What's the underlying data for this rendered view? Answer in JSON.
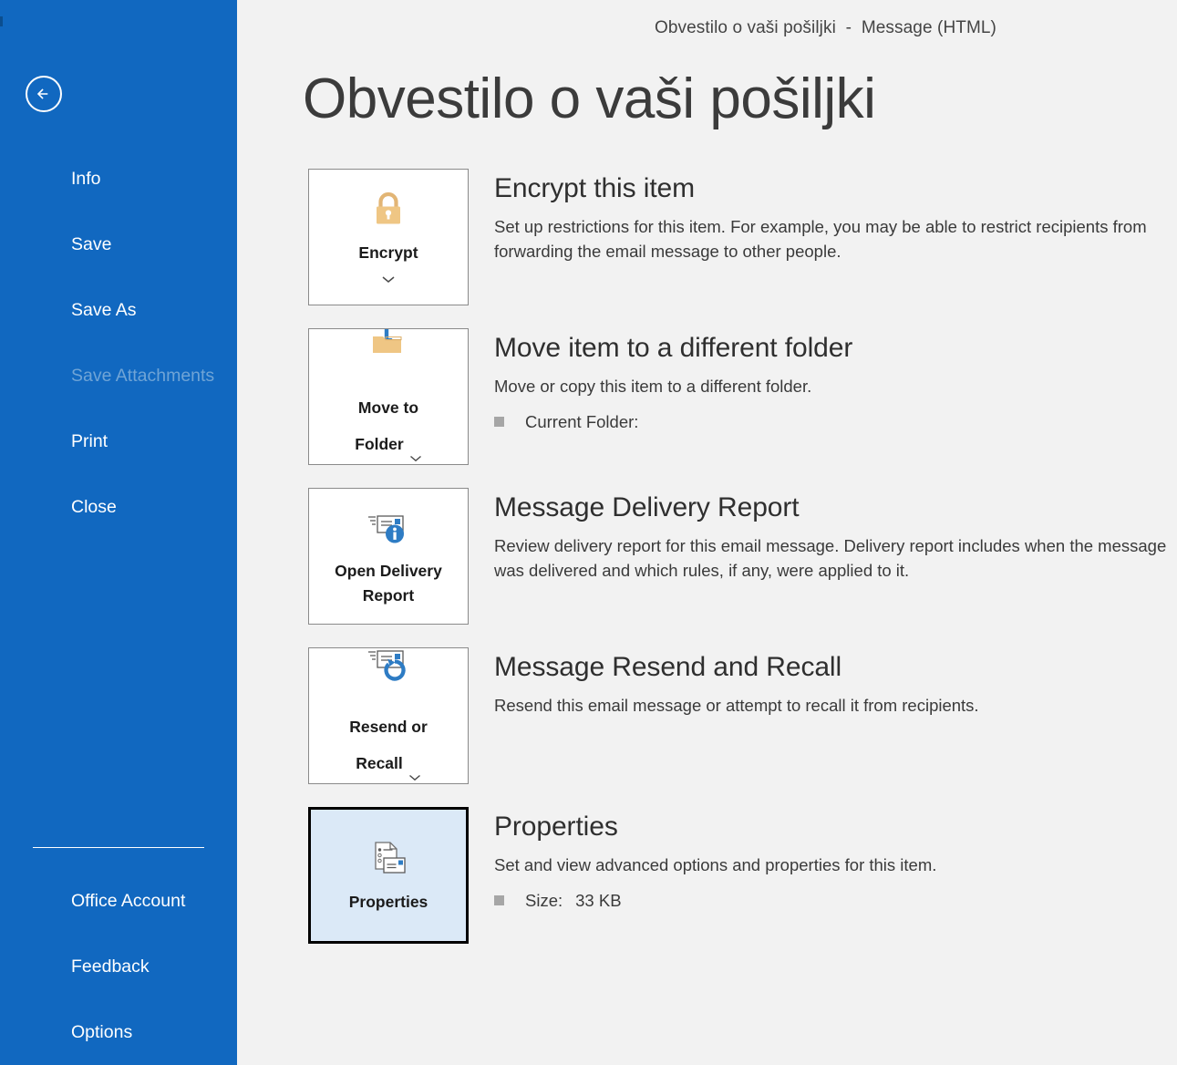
{
  "window": {
    "title": "Obvestilo o vaši pošiljki  -  Message (HTML)"
  },
  "colors": {
    "sidebar_blue": "#1168C0",
    "main_background": "#F2F2F2",
    "tile_selected_fill": "#DBE9F7",
    "tile_selected_border": "#000000",
    "accent_gold": "#E8BC7E",
    "accent_blue": "#2E7CC4",
    "disabled_text": "#6FA4D6"
  },
  "sidebar": {
    "back_icon": "back-arrow-icon",
    "items": [
      {
        "label": "Info",
        "disabled": false
      },
      {
        "label": "Save",
        "disabled": false
      },
      {
        "label": "Save As",
        "disabled": false
      },
      {
        "label": "Save Attachments",
        "disabled": true
      },
      {
        "label": "Print",
        "disabled": false
      },
      {
        "label": "Close",
        "disabled": false
      }
    ],
    "bottom_items": [
      {
        "label": "Office Account",
        "disabled": false
      },
      {
        "label": "Feedback",
        "disabled": false
      },
      {
        "label": "Options",
        "disabled": false
      }
    ]
  },
  "main": {
    "page_title": "Obvestilo o vaši pošiljki",
    "sections": [
      {
        "id": "encrypt",
        "tile_label": "Encrypt",
        "tile_icon": "padlock-icon",
        "chevron": "below",
        "selected": false,
        "heading": "Encrypt this item",
        "description": "Set up restrictions for this item. For example, you may be able to restrict recipients from forwarding the email message to other people.",
        "properties": []
      },
      {
        "id": "move-to-folder",
        "tile_label": "Move to\nFolder",
        "tile_icon": "move-to-folder-icon",
        "chevron": "inline",
        "selected": false,
        "heading": "Move item to a different folder",
        "description": "Move or copy this item to a different folder.",
        "properties": [
          {
            "label": "Current Folder:",
            "value": ""
          }
        ]
      },
      {
        "id": "delivery-report",
        "tile_label": "Open Delivery\nReport",
        "tile_icon": "delivery-report-icon",
        "chevron": "none",
        "selected": false,
        "heading": "Message Delivery Report",
        "description": "Review delivery report for this email message. Delivery report includes when the message was delivered and which rules, if any, were applied to it.",
        "properties": []
      },
      {
        "id": "resend-recall",
        "tile_label": "Resend or\nRecall",
        "tile_icon": "resend-recall-icon",
        "chevron": "inline",
        "selected": false,
        "heading": "Message Resend and Recall",
        "description": "Resend this email message or attempt to recall it from recipients.",
        "properties": []
      },
      {
        "id": "properties",
        "tile_label": "Properties",
        "tile_icon": "properties-icon",
        "chevron": "none",
        "selected": true,
        "heading": "Properties",
        "description": "Set and view advanced options and properties for this item.",
        "properties": [
          {
            "label": "Size:",
            "value": "33 KB"
          }
        ]
      }
    ]
  }
}
